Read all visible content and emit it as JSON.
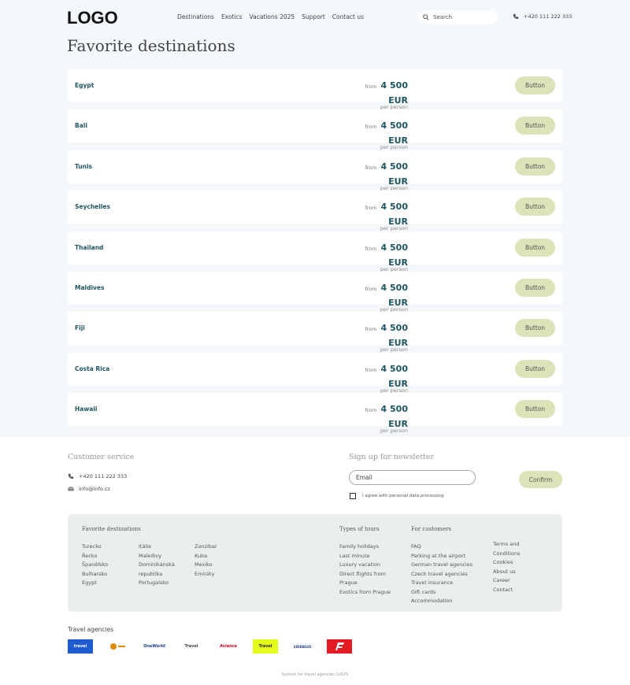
{
  "header": {
    "logo": "LOGO",
    "nav": [
      "Destinations",
      "Exotics",
      "Vacations 2025",
      "Support",
      "Contact us"
    ],
    "search_placeholder": "Search",
    "phone": "+420 111 222 333"
  },
  "page_title": "Favorite destinations",
  "destinations": [
    {
      "name": "Egypt",
      "from": "from",
      "price": "4 500 EUR",
      "per": "per person",
      "button": "Button"
    },
    {
      "name": "Bali",
      "from": "from",
      "price": "4 500 EUR",
      "per": "per person",
      "button": "Button"
    },
    {
      "name": "Tunis",
      "from": "from",
      "price": "4 500 EUR",
      "per": "per person",
      "button": "Button"
    },
    {
      "name": "Seychelles",
      "from": "from",
      "price": "4 500 EUR",
      "per": "per person",
      "button": "Button"
    },
    {
      "name": "Thailand",
      "from": "from",
      "price": "4 500 EUR",
      "per": "per person",
      "button": "Button"
    },
    {
      "name": "Maldives",
      "from": "from",
      "price": "4 500 EUR",
      "per": "per person",
      "button": "Button"
    },
    {
      "name": "Fiji",
      "from": "from",
      "price": "4 500 EUR",
      "per": "per person",
      "button": "Button"
    },
    {
      "name": "Costa Rica",
      "from": "from",
      "price": "4 500 EUR",
      "per": "per person",
      "button": "Button"
    },
    {
      "name": "Hawaii",
      "from": "from",
      "price": "4 500 EUR",
      "per": "per person",
      "button": "Button"
    }
  ],
  "footer": {
    "customer_service": {
      "title": "Customer service",
      "phone": "+420 111 222 333",
      "email": "info@info.cz"
    },
    "newsletter": {
      "title": "Sign up for newsletter",
      "email_placeholder": "Email",
      "confirm": "Confirm",
      "agree": "I agree with personal data processing"
    },
    "links": {
      "favorite_title": "Favorite destinations",
      "fav_col1": [
        "Turecko",
        "Řecko",
        "Španělsko",
        "Bulharsko",
        "Egypt"
      ],
      "fav_col2": [
        "Itálie",
        "Maledivy",
        "Dominikánská",
        "republika",
        "Portugalsko"
      ],
      "fav_col3": [
        "Zanzibar",
        "Kuba",
        "Mexiko",
        "Emiráty"
      ],
      "tours_title": "Types of tours",
      "tours": [
        "Family holidays",
        "Last minute",
        "Luxury vacation",
        "Direct flights from",
        "Prague",
        "Exotics from Prague"
      ],
      "customers_title": "For customers",
      "customers": [
        "FAQ",
        "Parking at the airport",
        "German travel agencies",
        "Czech travel agencies",
        "Travel insurance",
        "Gift cards",
        "Accommodation"
      ],
      "misc": [
        "Terms and",
        "Conditions",
        "Cookies",
        "About us",
        "Career",
        "Contact"
      ]
    },
    "agencies_title": "Travel agencies",
    "agencies": [
      {
        "label": "travel",
        "bg": "#1f5bd1",
        "fg": "#ffffff"
      },
      {
        "label": "",
        "bg": "#ffffff",
        "fg": "#e08a00"
      },
      {
        "label": "OneWorld",
        "bg": "#ffffff",
        "fg": "#1b3f8f"
      },
      {
        "label": "Travel",
        "bg": "#ffffff",
        "fg": "#444444"
      },
      {
        "label": "Avianca",
        "bg": "#ffffff",
        "fg": "#d6001c"
      },
      {
        "label": "Travel",
        "bg": "#e5ff1a",
        "fg": "#222222"
      },
      {
        "label": "SIDEBESO",
        "bg": "#ffffff",
        "fg": "#1b3f8f"
      },
      {
        "label": "",
        "bg": "#e51b24",
        "fg": "#ffffff"
      }
    ],
    "credit": "System for travel agencies CeSYS"
  }
}
